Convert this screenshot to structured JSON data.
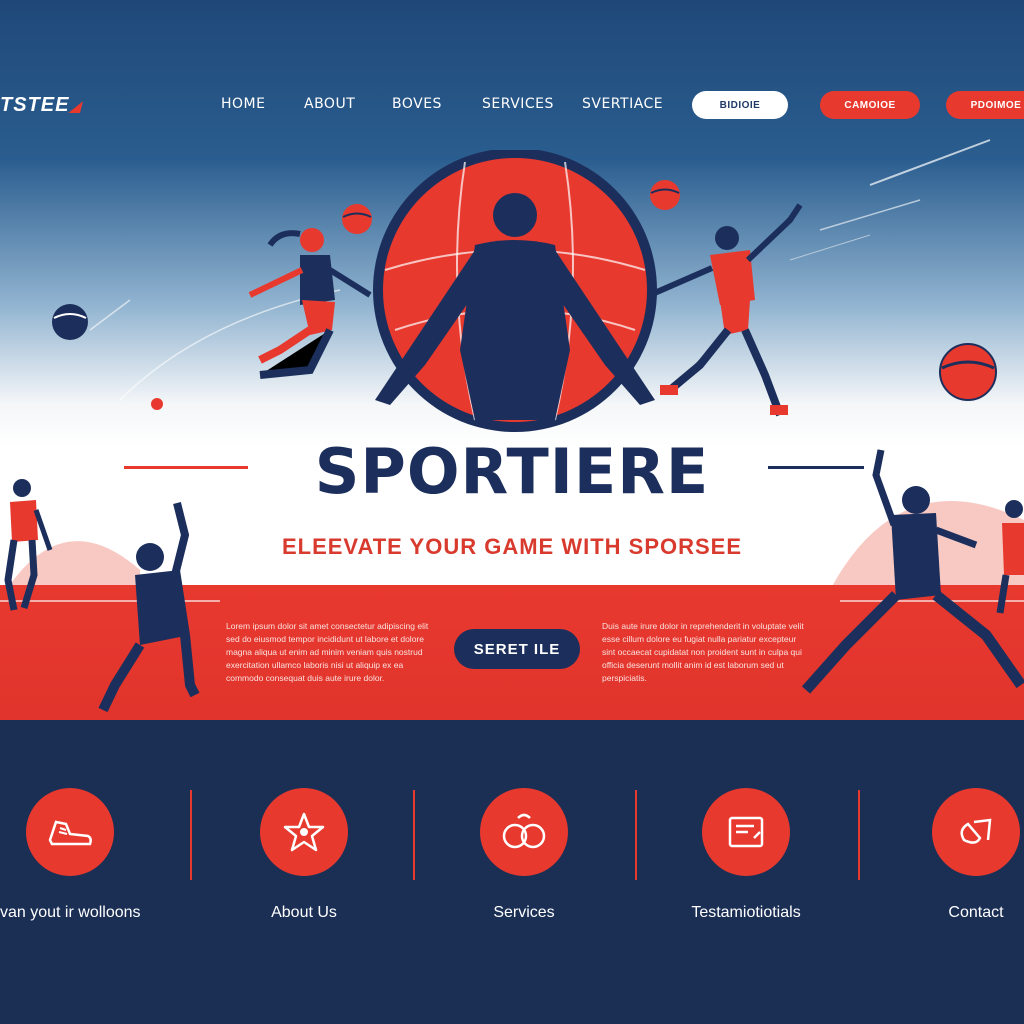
{
  "brand": {
    "logo_text": "TSTEE"
  },
  "nav": {
    "links": [
      "HOME",
      "ABOUT",
      "BOVES",
      "SERVICES",
      "SVERTIACE"
    ],
    "button_white": "BIDIOIE",
    "button_red_1": "CAMOIOE",
    "button_red_2": "PDOIMOE"
  },
  "hero": {
    "title": "SPORTIERE",
    "tagline": "ELEEVATE YOUR GAME WITH SPORSEE",
    "cta_label": "SERET ILE",
    "left_paragraph": "Lorem ipsum dolor sit amet consectetur adipiscing elit sed do eiusmod tempor incididunt ut labore et dolore magna aliqua ut enim ad minim veniam quis nostrud exercitation ullamco laboris nisi ut aliquip ex ea commodo consequat duis aute irure dolor.",
    "right_paragraph": "Duis aute irure dolor in reprehenderit in voluptate velit esse cillum dolore eu fugiat nulla pariatur excepteur sint occaecat cupidatat non proident sunt in culpa qui officia deserunt mollit anim id est laborum sed ut perspiciatis."
  },
  "footer": {
    "items": [
      {
        "label": "van yout ir wolloons",
        "icon": "sneaker-icon"
      },
      {
        "label": "About Us",
        "icon": "star-icon"
      },
      {
        "label": "Services",
        "icon": "gloves-icon"
      },
      {
        "label": "Testamiotiotials",
        "icon": "document-icon"
      },
      {
        "label": "Contact",
        "icon": "link-icon"
      }
    ]
  },
  "colors": {
    "navy": "#1c2f5c",
    "red": "#e8392f",
    "blue": "#1f4878",
    "white": "#ffffff"
  }
}
